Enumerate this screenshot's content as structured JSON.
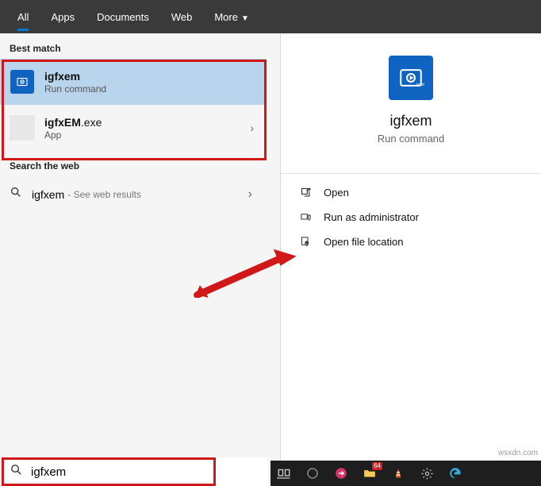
{
  "tabs": {
    "all": "All",
    "apps": "Apps",
    "documents": "Documents",
    "web": "Web",
    "more": "More"
  },
  "sections": {
    "best_match": "Best match",
    "search_web": "Search the web"
  },
  "results": {
    "item1": {
      "title": "igfxem",
      "subtitle": "Run command"
    },
    "item2": {
      "title_prefix": "igfxEM",
      "title_suffix": ".exe",
      "subtitle": "App"
    }
  },
  "web_result": {
    "term": "igfxem",
    "suffix": " - See web results"
  },
  "details": {
    "name": "igfxem",
    "type": "Run command",
    "actions": {
      "open": "Open",
      "admin": "Run as administrator",
      "location": "Open file location"
    }
  },
  "search": {
    "value": "igfxem"
  },
  "badge": "64",
  "watermark": "wsxdn.com"
}
